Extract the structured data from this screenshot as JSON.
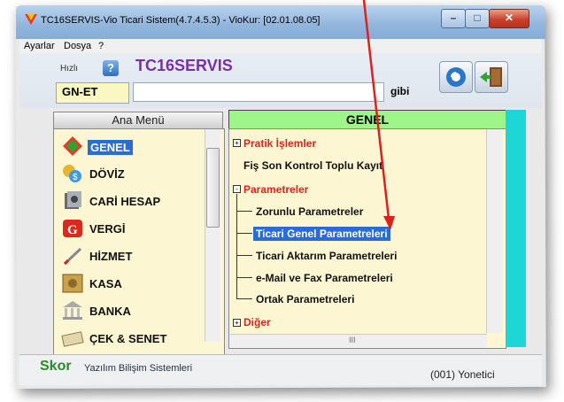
{
  "window": {
    "title": "TC16SERVIS-Vio Ticari Sistem(4.7.4.5.3)  -  VioKur: [02.01.08.05]",
    "controls": [
      "minimize",
      "maximize",
      "close"
    ]
  },
  "menubar": [
    "Ayarlar",
    "Dosya",
    "?"
  ],
  "toolbar": {
    "hizli_label": "Hızlı",
    "help_icon": "?",
    "company_name": "TC16SERVIS",
    "code_value": "GN-ET",
    "search_value": "",
    "gibi_label": "gibi",
    "icons": [
      "refresh-icon",
      "exit-door-icon"
    ]
  },
  "left_panel": {
    "header": "Ana Menü",
    "items": [
      {
        "label": "GENEL",
        "icon": "genel-icon",
        "selected": true
      },
      {
        "label": "DÖVİZ",
        "icon": "coins-icon"
      },
      {
        "label": "CARİ HESAP",
        "icon": "ledger-icon"
      },
      {
        "label": "VERGİ",
        "icon": "tax-icon"
      },
      {
        "label": "HİZMET",
        "icon": "pen-icon"
      },
      {
        "label": "KASA",
        "icon": "safe-icon"
      },
      {
        "label": "BANKA",
        "icon": "bank-icon"
      },
      {
        "label": "ÇEK & SENET",
        "icon": "check-icon"
      }
    ]
  },
  "right_panel": {
    "header": "GENEL",
    "tree": [
      {
        "label": "Pratik İşlemler",
        "type": "group",
        "expander": "+"
      },
      {
        "label": "Fiş Son Kontrol Toplu Kayıt",
        "type": "item"
      },
      {
        "label": "Parametreler",
        "type": "group",
        "expander": "-"
      },
      {
        "label": "Zorunlu Parametreler",
        "type": "child"
      },
      {
        "label": "Ticari Genel Parametreleri",
        "type": "child",
        "selected": true
      },
      {
        "label": "Ticari Aktarım Parametreleri",
        "type": "child"
      },
      {
        "label": "e-Mail ve Fax Parametreleri",
        "type": "child"
      },
      {
        "label": "Ortak Parametreleri",
        "type": "child"
      },
      {
        "label": "Diğer",
        "type": "group",
        "expander": "+"
      }
    ],
    "hscroll_glyph": "III"
  },
  "statusbar": {
    "brand": "Skor",
    "company": "Yazılım Bilişim Sistemleri",
    "user": "(001) Yonetici"
  },
  "colors": {
    "accent_green": "#9ef58a",
    "panel_bg": "#fcf6d2",
    "selection": "#2a6bd6",
    "group_red": "#d42a1e",
    "company_purple": "#7a2ea8",
    "teal": "#1fd6d6",
    "arrow_red": "#e0201a"
  }
}
